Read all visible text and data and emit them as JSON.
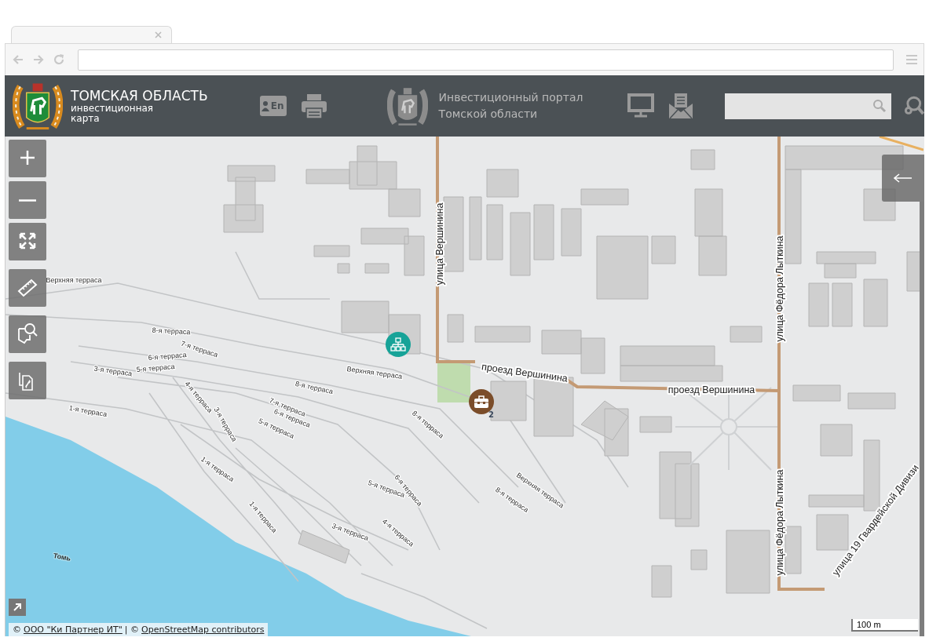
{
  "header": {
    "title": "ТОМСКАЯ ОБЛАСТЬ",
    "subtitle": "инвестиционная карта",
    "language_badge": "En",
    "portal_link": "Инвестиционный портал Томской области"
  },
  "map_controls": [
    {
      "kind": "zoom_in"
    },
    {
      "kind": "zoom_out"
    },
    {
      "kind": "fullscreen"
    },
    {
      "kind": "measure"
    },
    {
      "kind": "area_search"
    },
    {
      "kind": "share_link"
    }
  ],
  "markers": [
    {
      "kind": "structure",
      "color": "#17a398"
    },
    {
      "kind": "portfolio",
      "color": "#7b4d2a",
      "count": "2"
    }
  ],
  "labels": [
    {
      "kind": "street",
      "text": "улица Вершинина"
    },
    {
      "kind": "terrace",
      "text": "Верхняя терраса"
    },
    {
      "kind": "terrace",
      "text": "8-я терраса"
    },
    {
      "kind": "terrace",
      "text": "7-я терраса"
    },
    {
      "kind": "terrace",
      "text": "6-я терраса"
    },
    {
      "kind": "terrace",
      "text": "5-я терраса"
    },
    {
      "kind": "terrace",
      "text": "3-я терраса"
    },
    {
      "kind": "terrace",
      "text": "Верхняя терраса"
    },
    {
      "kind": "street",
      "text": "проезд Вершинина"
    },
    {
      "kind": "terrace",
      "text": "8-я терраса"
    },
    {
      "kind": "terrace",
      "text": "4-я терраса"
    },
    {
      "kind": "street",
      "text": "проезд Вершинина"
    },
    {
      "kind": "street",
      "text": "улица Фёдора Лыткина"
    },
    {
      "kind": "terrace",
      "text": "1-я терраса"
    },
    {
      "kind": "terrace",
      "text": "7-я терраса"
    },
    {
      "kind": "terrace",
      "text": "6-я терраса"
    },
    {
      "kind": "terrace",
      "text": "3-я терраса"
    },
    {
      "kind": "terrace",
      "text": "5-я терраса"
    },
    {
      "kind": "terrace",
      "text": "8-я терраса"
    },
    {
      "kind": "terrace",
      "text": "1-я терраса"
    },
    {
      "kind": "terrace",
      "text": "5-я терраса"
    },
    {
      "kind": "terrace",
      "text": "6-я терраса"
    },
    {
      "kind": "terrace",
      "text": "8-я терраса"
    },
    {
      "kind": "terrace",
      "text": "Верхняя терраса"
    },
    {
      "kind": "terrace",
      "text": "1-я терраса"
    },
    {
      "kind": "terrace",
      "text": "3-я терраса"
    },
    {
      "kind": "terrace",
      "text": "4-я терраса"
    },
    {
      "kind": "water",
      "text": "Томь"
    },
    {
      "kind": "street",
      "text": "улица Фёдора Лыткина"
    },
    {
      "kind": "street",
      "text": "улица 19 Гвардейской Дивизи"
    }
  ],
  "scale": "100 m",
  "attribution": {
    "prefix": "©",
    "links": [
      "ООО \"Ки Партнер ИТ\"",
      "OpenStreetMap contributors"
    ],
    "separator": "| ©"
  }
}
